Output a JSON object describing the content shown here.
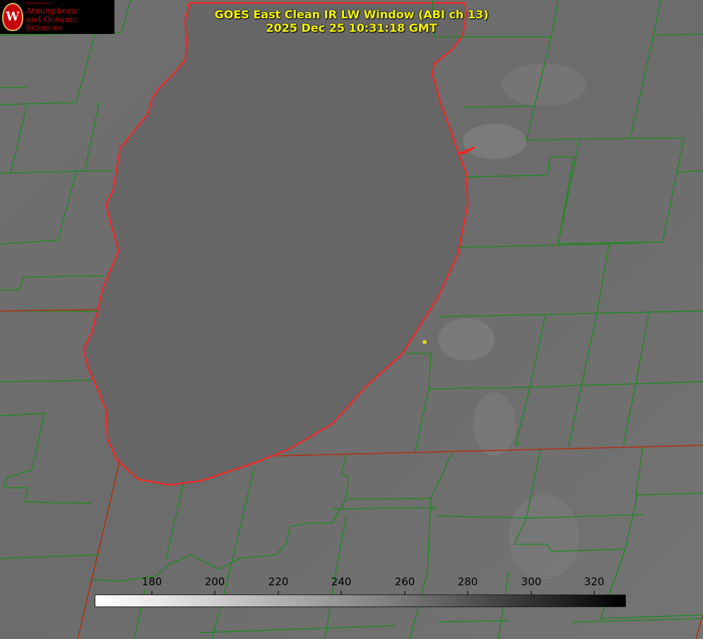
{
  "title": {
    "line1": "GOES East Clean IR LW Window (ABI ch 13)",
    "line2": "2025 Dec 25 10:31:18 GMT"
  },
  "logo": {
    "icon": "university-crest-icon",
    "crest_letter": "W",
    "dept": "Department of",
    "line1": "Atmospheric",
    "line2": "and Oceanic Sciences"
  },
  "colorbar": {
    "ticks": [
      "180",
      "200",
      "220",
      "240",
      "260",
      "280",
      "300",
      "320"
    ],
    "colors": {
      "low": "#ffffff",
      "high": "#000000"
    }
  },
  "colors": {
    "county_border": "#1a8a1a",
    "state_border": "#b03010",
    "coastline": "#ff2020",
    "marker": "#e0d020",
    "title": "#f2f200"
  }
}
